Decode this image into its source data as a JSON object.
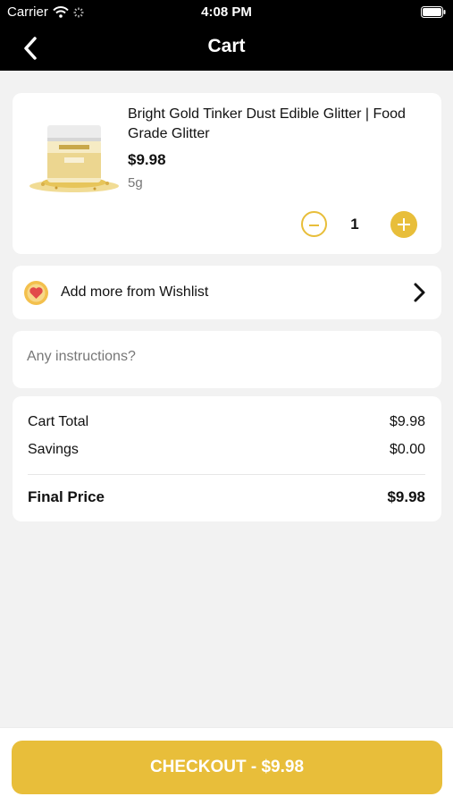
{
  "status_bar": {
    "carrier": "Carrier",
    "time": "4:08 PM"
  },
  "nav": {
    "title": "Cart"
  },
  "cart_item": {
    "name": "Bright Gold Tinker Dust Edible Glitter | Food Grade Glitter",
    "price": "$9.98",
    "weight": "5g",
    "quantity": "1"
  },
  "wishlist": {
    "label": "Add more from Wishlist"
  },
  "instructions": {
    "placeholder": "Any instructions?",
    "value": ""
  },
  "totals": {
    "cart_total_label": "Cart Total",
    "cart_total_value": "$9.98",
    "savings_label": "Savings",
    "savings_value": "$0.00",
    "final_label": "Final Price",
    "final_value": "$9.98"
  },
  "checkout": {
    "label": "CHECKOUT - $9.98"
  },
  "colors": {
    "accent": "#e8be3a",
    "nav_bg": "#000000",
    "page_bg": "#f2f2f2"
  }
}
